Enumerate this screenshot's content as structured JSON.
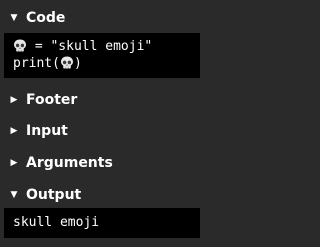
{
  "sections": {
    "code": {
      "label": "Code",
      "expanded": true,
      "caret": "▼"
    },
    "footer": {
      "label": "Footer",
      "expanded": false,
      "caret": "▶"
    },
    "input": {
      "label": "Input",
      "expanded": false,
      "caret": "▶"
    },
    "arguments": {
      "label": "Arguments",
      "expanded": false,
      "caret": "▶"
    },
    "output": {
      "label": "Output",
      "expanded": true,
      "caret": "▼"
    }
  },
  "code": {
    "line1_rest": " = \"skull emoji\"",
    "line2_prefix": "print(",
    "line2_suffix": ")"
  },
  "output": {
    "text": "skull emoji"
  },
  "icons": {
    "skull": "skull-emoji",
    "expanded": "caret-down-icon",
    "collapsed": "caret-right-icon"
  },
  "colors": {
    "background": "#2a2a2a",
    "panel": "#000000",
    "text": "#ffffff"
  }
}
